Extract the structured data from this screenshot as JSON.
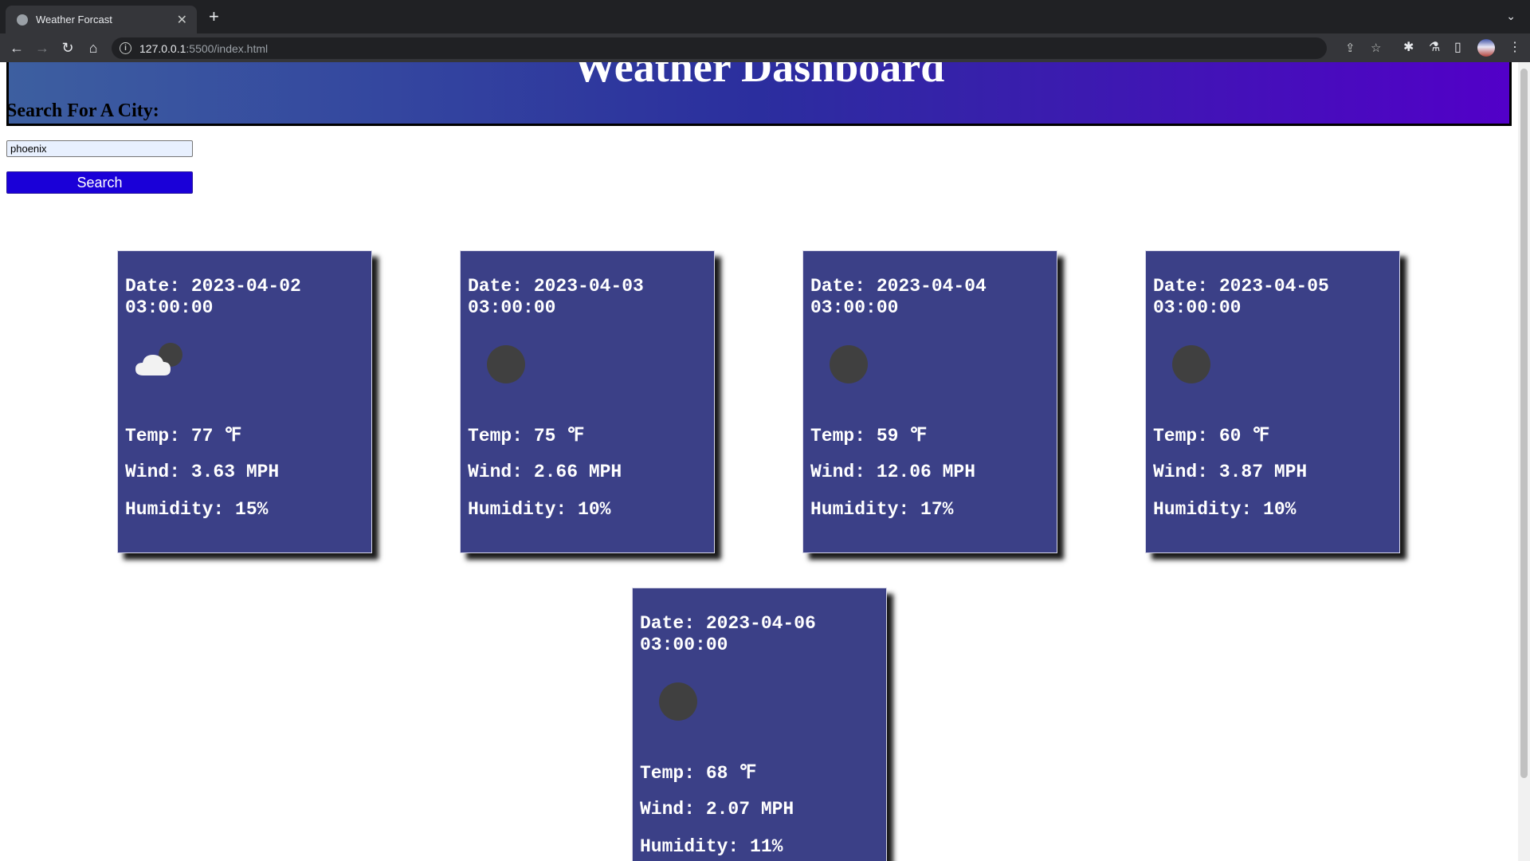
{
  "browser": {
    "tab_title": "Weather Forcast",
    "url_host": "127.0.0.1",
    "url_path": ":5500/index.html"
  },
  "page": {
    "header_title": "Weather Dashboard",
    "search_label": "Search For A City:",
    "search_value": "phoenix",
    "search_button": "Search"
  },
  "forecast": [
    {
      "date": "Date: 2023-04-02 03:00:00",
      "icon": "cloudy-night-icon",
      "temp": "Temp: 77 ℉",
      "wind": "Wind: 3.63 MPH",
      "humidity": "Humidity: 15%"
    },
    {
      "date": "Date: 2023-04-03 03:00:00",
      "icon": "clear-night-icon",
      "temp": "Temp: 75 ℉",
      "wind": "Wind: 2.66 MPH",
      "humidity": "Humidity: 10%"
    },
    {
      "date": "Date: 2023-04-04 03:00:00",
      "icon": "clear-night-icon",
      "temp": "Temp: 59 ℉",
      "wind": "Wind: 12.06 MPH",
      "humidity": "Humidity: 17%"
    },
    {
      "date": "Date: 2023-04-05 03:00:00",
      "icon": "clear-night-icon",
      "temp": "Temp: 60 ℉",
      "wind": "Wind: 3.87 MPH",
      "humidity": "Humidity: 10%"
    },
    {
      "date": "Date: 2023-04-06 03:00:00",
      "icon": "clear-night-icon",
      "temp": "Temp: 68 ℉",
      "wind": "Wind: 2.07 MPH",
      "humidity": "Humidity: 11%"
    }
  ]
}
